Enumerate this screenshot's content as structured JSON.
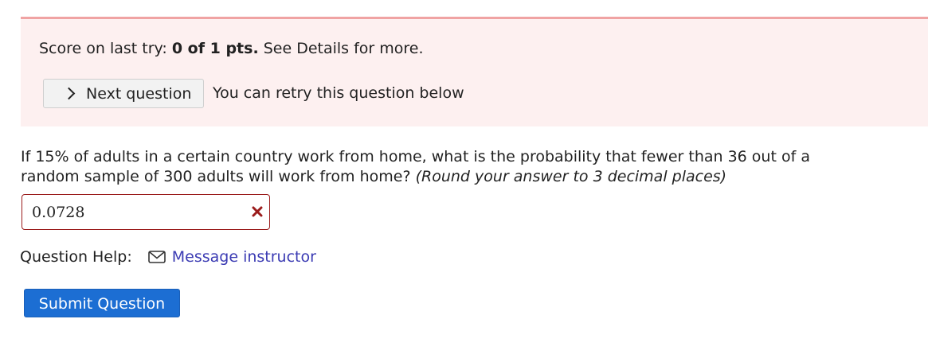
{
  "score": {
    "prefix": "Score on last try: ",
    "value": "0 of 1 pts.",
    "suffix": " See Details for more."
  },
  "next_button": {
    "label": "Next question"
  },
  "retry_note": "You can retry this question below",
  "question": {
    "text": "If 15% of adults in a certain country work from home, what is the probability that fewer than 36 out of a random sample of 300 adults will work from home? ",
    "instruction": "(Round your answer to 3 decimal places)"
  },
  "answer": {
    "value": "0.0728",
    "status": "incorrect",
    "status_icon": "x-icon",
    "status_color": "#9b1c1c"
  },
  "help": {
    "label": "Question Help:",
    "link_icon": "mail-icon",
    "link_label": "Message instructor",
    "link_color": "#3b3bb3"
  },
  "submit_button": {
    "label": "Submit Question",
    "color": "#1c6ed3"
  },
  "colors": {
    "score_panel_bg": "#fdf0f0",
    "score_panel_border": "#f0a3a3"
  }
}
